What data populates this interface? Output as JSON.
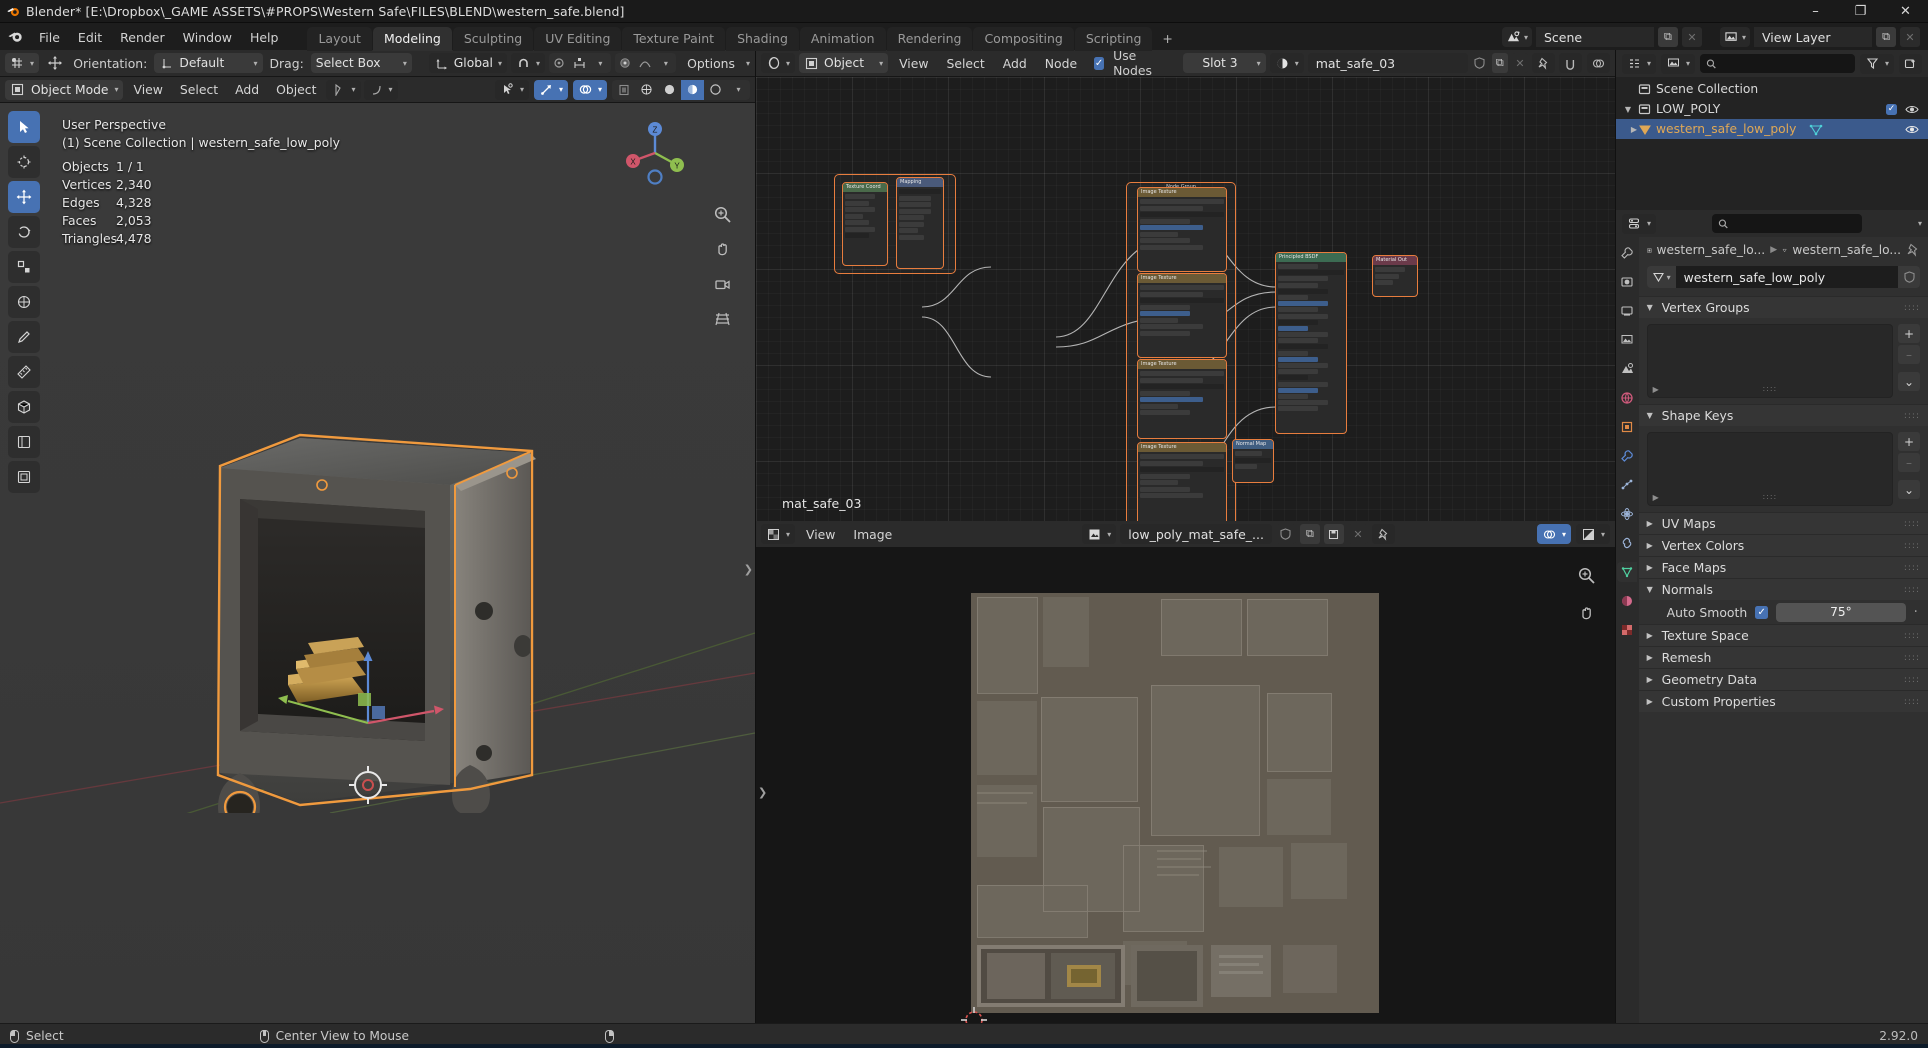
{
  "window": {
    "title": "Blender* [E:\\Dropbox\\_GAME ASSETS\\#PROPS\\Western Safe\\FILES\\BLEND\\western_safe.blend]",
    "minimize": "–",
    "maximize": "❐",
    "close": "✕"
  },
  "topbar": {
    "menus": [
      "File",
      "Edit",
      "Render",
      "Window",
      "Help"
    ],
    "workspaces": [
      {
        "label": "Layout",
        "active": false
      },
      {
        "label": "Modeling",
        "active": true
      },
      {
        "label": "Sculpting",
        "active": false
      },
      {
        "label": "UV Editing",
        "active": false
      },
      {
        "label": "Texture Paint",
        "active": false
      },
      {
        "label": "Shading",
        "active": false
      },
      {
        "label": "Animation",
        "active": false
      },
      {
        "label": "Rendering",
        "active": false
      },
      {
        "label": "Compositing",
        "active": false
      },
      {
        "label": "Scripting",
        "active": false
      }
    ],
    "add_workspace": "+",
    "scene_name": "Scene",
    "view_layer_name": "View Layer",
    "copy_glyph": "⧉",
    "x_glyph": "✕"
  },
  "tool_header": {
    "orientation_label": "Orientation:",
    "orientation_value": "Default",
    "drag_label": "Drag:",
    "drag_value": "Select Box",
    "transform_orientation": "Global",
    "options_label": "Options"
  },
  "viewport_header": {
    "mode": "Object Mode",
    "menus": [
      "View",
      "Select",
      "Add",
      "Object"
    ]
  },
  "viewport": {
    "perspective": "User Perspective",
    "scene_line": "(1) Scene Collection | western_safe_low_poly",
    "stats": [
      {
        "key": "Objects",
        "value": "1 / 1"
      },
      {
        "key": "Vertices",
        "value": "2,340"
      },
      {
        "key": "Edges",
        "value": "4,328"
      },
      {
        "key": "Faces",
        "value": "2,053"
      },
      {
        "key": "Triangles",
        "value": "4,478"
      }
    ],
    "gizmo_axes": [
      "X",
      "Y",
      "Z"
    ]
  },
  "shader_editor": {
    "editor_type": "shader-editor",
    "object_selector": "Object",
    "menus": [
      "View",
      "Select",
      "Add",
      "Node"
    ],
    "use_nodes_label": "Use Nodes",
    "use_nodes_checked": true,
    "slot": "Slot 3",
    "material_name": "mat_safe_03",
    "material_label": "mat_safe_03",
    "frame_label": "Node Group"
  },
  "uv_editor": {
    "menus": [
      "View",
      "Image"
    ],
    "image_name": "low_poly_mat_safe_...",
    "x_glyph": "✕"
  },
  "outliner": {
    "search_placeholder": "",
    "rows": [
      {
        "label": "Scene Collection",
        "indent": 0,
        "type": "collection",
        "selected": false,
        "expanded": null,
        "checkbox": false,
        "eye": false
      },
      {
        "label": "LOW_POLY",
        "indent": 1,
        "type": "collection",
        "selected": false,
        "expanded": true,
        "checkbox": true,
        "eye": true
      },
      {
        "label": "western_safe_low_poly",
        "indent": 2,
        "type": "object",
        "selected": true,
        "expanded": false,
        "checkbox": false,
        "eye": true
      }
    ]
  },
  "properties": {
    "search_placeholder": "",
    "breadcrumb": [
      "western_safe_lo...",
      "western_safe_lo..."
    ],
    "object_data_name": "western_safe_low_poly",
    "panels": [
      {
        "label": "Vertex Groups",
        "open": true,
        "kind": "list"
      },
      {
        "label": "Shape Keys",
        "open": true,
        "kind": "list"
      },
      {
        "label": "UV Maps",
        "open": false,
        "kind": "none"
      },
      {
        "label": "Vertex Colors",
        "open": false,
        "kind": "none"
      },
      {
        "label": "Face Maps",
        "open": false,
        "kind": "none"
      },
      {
        "label": "Normals",
        "open": true,
        "kind": "normals"
      },
      {
        "label": "Texture Space",
        "open": false,
        "kind": "none"
      },
      {
        "label": "Remesh",
        "open": false,
        "kind": "none"
      },
      {
        "label": "Geometry Data",
        "open": false,
        "kind": "none"
      },
      {
        "label": "Custom Properties",
        "open": false,
        "kind": "none"
      }
    ],
    "normals": {
      "auto_smooth_label": "Auto Smooth",
      "auto_smooth_checked": true,
      "angle_value": "75°"
    },
    "list_add": "+",
    "list_remove": "–",
    "list_menu": "⌄"
  },
  "statusbar": {
    "items": [
      {
        "mouse": "left",
        "label": "Select"
      },
      {
        "mouse": "middle",
        "label": "Center View to Mouse"
      },
      {
        "mouse": "right",
        "label": ""
      }
    ],
    "version": "2.92.0"
  },
  "colors": {
    "accent_blue": "#4772b3",
    "selection_orange": "#e87d3e",
    "outliner_object_text": "#e0a856",
    "panel_bg": "#303030",
    "header_bg": "#2b2b2b",
    "viewport_bg": "#393939"
  }
}
